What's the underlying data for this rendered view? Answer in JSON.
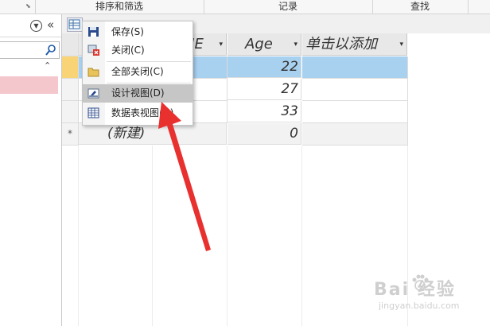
{
  "ribbon": {
    "groups": [
      "排序和筛选",
      "记录",
      "查找"
    ]
  },
  "nav": {
    "collapse_glyph": "«",
    "search_icon": "search-icon",
    "scroll_glyph": "⌃"
  },
  "table": {
    "columns": [
      "ME",
      "Age",
      "单击以添加"
    ],
    "rows": [
      {
        "age": "22",
        "selected": true
      },
      {
        "age": "27"
      },
      {
        "age": "33"
      }
    ],
    "new_row": {
      "marker": "*",
      "label": "(新建)",
      "age": "0"
    }
  },
  "context_menu": {
    "items": [
      {
        "label": "保存(S)",
        "icon": "save-icon"
      },
      {
        "label": "关闭(C)",
        "icon": "close-icon"
      },
      {
        "label": "全部关闭(C)",
        "icon": "folder-icon"
      },
      {
        "label": "设计视图(D)",
        "icon": "design-view-icon",
        "highlighted": true
      },
      {
        "label": "数据表视图(H)",
        "icon": "datasheet-icon"
      }
    ]
  },
  "annotation": {
    "arrow_color": "#e8302f"
  },
  "watermark": {
    "brand": "Bai 经验",
    "url": "jingyan.baidu.com"
  }
}
